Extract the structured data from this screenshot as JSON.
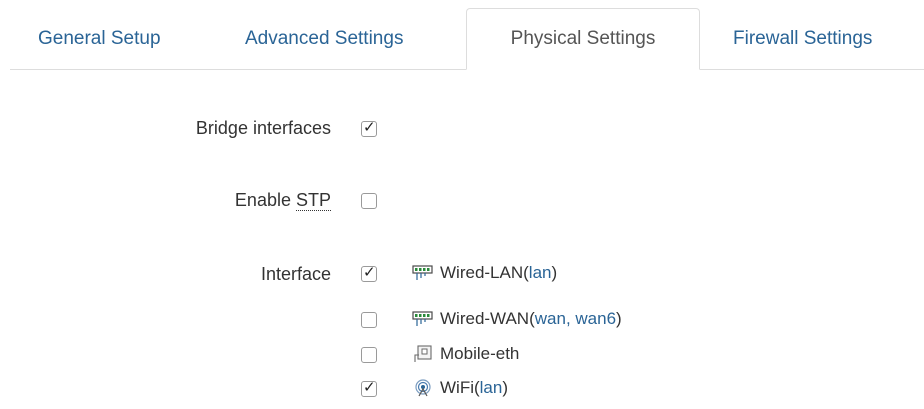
{
  "tabs": [
    {
      "label": "General Setup",
      "active": false
    },
    {
      "label": "Advanced Settings",
      "active": false
    },
    {
      "label": "Physical Settings",
      "active": true
    },
    {
      "label": "Firewall Settings",
      "active": false
    }
  ],
  "bridge_interfaces": {
    "label": "Bridge interfaces",
    "checked": true
  },
  "enable_stp": {
    "label_prefix": "Enable ",
    "label_abbr": "STP",
    "checked": false
  },
  "interface": {
    "label": "Interface",
    "items": [
      {
        "name": "Wired-LAN",
        "open": " (",
        "networks": "lan",
        "close": ")",
        "icon": "ethernet-switch-icon",
        "checked": true
      },
      {
        "name": "Wired-WAN",
        "open": " (",
        "networks": "wan, wan6",
        "close": ")",
        "icon": "ethernet-switch-icon",
        "checked": false
      },
      {
        "name": "Mobile-eth",
        "icon": "ethernet-port-icon",
        "checked": false
      },
      {
        "name": "WiFi",
        "open": " (",
        "networks": "lan",
        "close": ")",
        "icon": "wifi-icon",
        "checked": true
      }
    ]
  },
  "colors": {
    "link": "#2a6496",
    "text": "#333333",
    "border": "#dddddd"
  }
}
